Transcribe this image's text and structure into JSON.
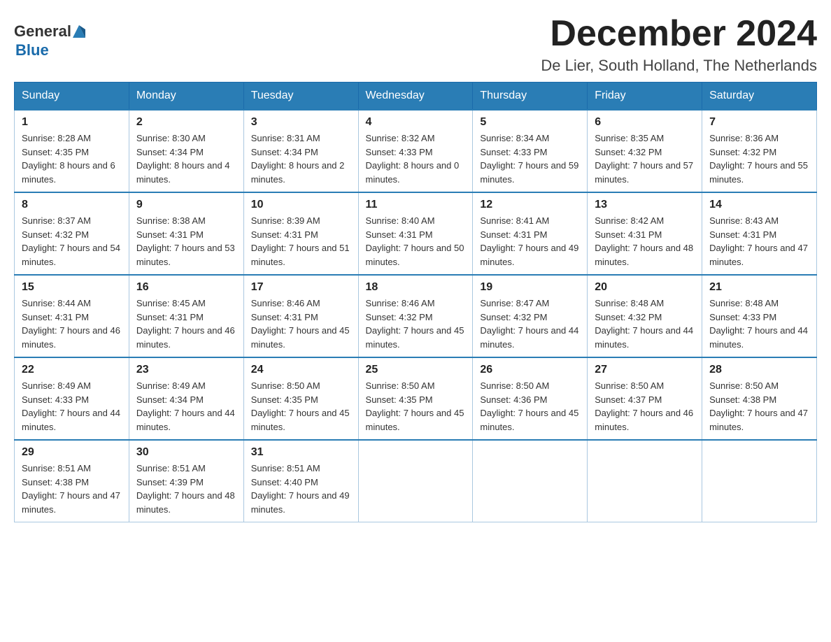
{
  "logo": {
    "text_general": "General",
    "triangle": "▶",
    "text_blue": "Blue"
  },
  "header": {
    "month_year": "December 2024",
    "location": "De Lier, South Holland, The Netherlands"
  },
  "days_of_week": [
    "Sunday",
    "Monday",
    "Tuesday",
    "Wednesday",
    "Thursday",
    "Friday",
    "Saturday"
  ],
  "weeks": [
    [
      {
        "day": "1",
        "sunrise": "8:28 AM",
        "sunset": "4:35 PM",
        "daylight": "8 hours and 6 minutes."
      },
      {
        "day": "2",
        "sunrise": "8:30 AM",
        "sunset": "4:34 PM",
        "daylight": "8 hours and 4 minutes."
      },
      {
        "day": "3",
        "sunrise": "8:31 AM",
        "sunset": "4:34 PM",
        "daylight": "8 hours and 2 minutes."
      },
      {
        "day": "4",
        "sunrise": "8:32 AM",
        "sunset": "4:33 PM",
        "daylight": "8 hours and 0 minutes."
      },
      {
        "day": "5",
        "sunrise": "8:34 AM",
        "sunset": "4:33 PM",
        "daylight": "7 hours and 59 minutes."
      },
      {
        "day": "6",
        "sunrise": "8:35 AM",
        "sunset": "4:32 PM",
        "daylight": "7 hours and 57 minutes."
      },
      {
        "day": "7",
        "sunrise": "8:36 AM",
        "sunset": "4:32 PM",
        "daylight": "7 hours and 55 minutes."
      }
    ],
    [
      {
        "day": "8",
        "sunrise": "8:37 AM",
        "sunset": "4:32 PM",
        "daylight": "7 hours and 54 minutes."
      },
      {
        "day": "9",
        "sunrise": "8:38 AM",
        "sunset": "4:31 PM",
        "daylight": "7 hours and 53 minutes."
      },
      {
        "day": "10",
        "sunrise": "8:39 AM",
        "sunset": "4:31 PM",
        "daylight": "7 hours and 51 minutes."
      },
      {
        "day": "11",
        "sunrise": "8:40 AM",
        "sunset": "4:31 PM",
        "daylight": "7 hours and 50 minutes."
      },
      {
        "day": "12",
        "sunrise": "8:41 AM",
        "sunset": "4:31 PM",
        "daylight": "7 hours and 49 minutes."
      },
      {
        "day": "13",
        "sunrise": "8:42 AM",
        "sunset": "4:31 PM",
        "daylight": "7 hours and 48 minutes."
      },
      {
        "day": "14",
        "sunrise": "8:43 AM",
        "sunset": "4:31 PM",
        "daylight": "7 hours and 47 minutes."
      }
    ],
    [
      {
        "day": "15",
        "sunrise": "8:44 AM",
        "sunset": "4:31 PM",
        "daylight": "7 hours and 46 minutes."
      },
      {
        "day": "16",
        "sunrise": "8:45 AM",
        "sunset": "4:31 PM",
        "daylight": "7 hours and 46 minutes."
      },
      {
        "day": "17",
        "sunrise": "8:46 AM",
        "sunset": "4:31 PM",
        "daylight": "7 hours and 45 minutes."
      },
      {
        "day": "18",
        "sunrise": "8:46 AM",
        "sunset": "4:32 PM",
        "daylight": "7 hours and 45 minutes."
      },
      {
        "day": "19",
        "sunrise": "8:47 AM",
        "sunset": "4:32 PM",
        "daylight": "7 hours and 44 minutes."
      },
      {
        "day": "20",
        "sunrise": "8:48 AM",
        "sunset": "4:32 PM",
        "daylight": "7 hours and 44 minutes."
      },
      {
        "day": "21",
        "sunrise": "8:48 AM",
        "sunset": "4:33 PM",
        "daylight": "7 hours and 44 minutes."
      }
    ],
    [
      {
        "day": "22",
        "sunrise": "8:49 AM",
        "sunset": "4:33 PM",
        "daylight": "7 hours and 44 minutes."
      },
      {
        "day": "23",
        "sunrise": "8:49 AM",
        "sunset": "4:34 PM",
        "daylight": "7 hours and 44 minutes."
      },
      {
        "day": "24",
        "sunrise": "8:50 AM",
        "sunset": "4:35 PM",
        "daylight": "7 hours and 45 minutes."
      },
      {
        "day": "25",
        "sunrise": "8:50 AM",
        "sunset": "4:35 PM",
        "daylight": "7 hours and 45 minutes."
      },
      {
        "day": "26",
        "sunrise": "8:50 AM",
        "sunset": "4:36 PM",
        "daylight": "7 hours and 45 minutes."
      },
      {
        "day": "27",
        "sunrise": "8:50 AM",
        "sunset": "4:37 PM",
        "daylight": "7 hours and 46 minutes."
      },
      {
        "day": "28",
        "sunrise": "8:50 AM",
        "sunset": "4:38 PM",
        "daylight": "7 hours and 47 minutes."
      }
    ],
    [
      {
        "day": "29",
        "sunrise": "8:51 AM",
        "sunset": "4:38 PM",
        "daylight": "7 hours and 47 minutes."
      },
      {
        "day": "30",
        "sunrise": "8:51 AM",
        "sunset": "4:39 PM",
        "daylight": "7 hours and 48 minutes."
      },
      {
        "day": "31",
        "sunrise": "8:51 AM",
        "sunset": "4:40 PM",
        "daylight": "7 hours and 49 minutes."
      },
      null,
      null,
      null,
      null
    ]
  ]
}
